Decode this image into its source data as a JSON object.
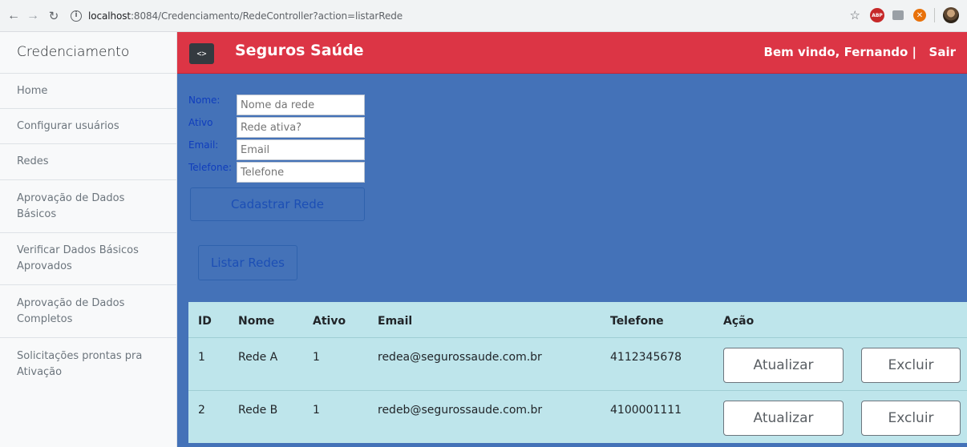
{
  "browser": {
    "url_host": "localhost",
    "url_rest": ":8084/Credenciamento/RedeController?action=listarRede",
    "info_glyph": "i",
    "abp_label": "ABP"
  },
  "sidebar": {
    "heading": "Credenciamento",
    "items": [
      {
        "label": "Home"
      },
      {
        "label": "Configurar usuários"
      },
      {
        "label": "Redes"
      },
      {
        "label": "Aprovação de Dados Básicos"
      },
      {
        "label": "Verificar Dados Básicos Aprovados"
      },
      {
        "label": "Aprovação de Dados Completos"
      },
      {
        "label": "Solicitações prontas pra Ativação"
      }
    ]
  },
  "topnav": {
    "toggle_label": "<>",
    "brand": "Seguros Saúde",
    "welcome": "Bem vindo, Fernando |",
    "logout": "Sair"
  },
  "form": {
    "nome_label": "Nome:",
    "nome_placeholder": "Nome da rede",
    "ativo_label": "Ativo",
    "ativo_placeholder": "Rede ativa?",
    "email_label": "Email:",
    "email_placeholder": "Email",
    "telefone_label": "Telefone:",
    "telefone_placeholder": "Telefone",
    "submit_label": "Cadastrar Rede"
  },
  "list_button": "Listar Redes",
  "table": {
    "headers": [
      "ID",
      "Nome",
      "Ativo",
      "Email",
      "Telefone",
      "Ação"
    ],
    "rows": [
      {
        "id": "1",
        "nome": "Rede A",
        "ativo": "1",
        "email": "redea@segurossaude.com.br",
        "telefone": "4112345678",
        "update_label": "Atualizar",
        "delete_label": "Excluir"
      },
      {
        "id": "2",
        "nome": "Rede B",
        "ativo": "1",
        "email": "redeb@segurossaude.com.br",
        "telefone": "4100001111",
        "update_label": "Atualizar",
        "delete_label": "Excluir"
      }
    ]
  },
  "colors": {
    "topnav_bg": "#dc3545",
    "main_bg": "#4472b8",
    "table_bg": "#bee5eb",
    "label_color": "#0f3dbd"
  }
}
